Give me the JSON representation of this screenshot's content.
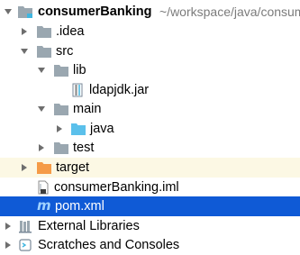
{
  "project_tree": {
    "root": {
      "name": "consumerBanking",
      "path": "~/workspace/java/consumer"
    },
    "idea": {
      "name": ".idea"
    },
    "src": {
      "name": "src"
    },
    "lib": {
      "name": "lib"
    },
    "jar": {
      "name": "ldapjdk.jar"
    },
    "main": {
      "name": "main"
    },
    "java": {
      "name": "java"
    },
    "test": {
      "name": "test"
    },
    "target": {
      "name": "target"
    },
    "iml": {
      "name": "consumerBanking.iml"
    },
    "pom": {
      "name": "pom.xml"
    },
    "external_libraries": {
      "name": "External Libraries"
    },
    "scratches": {
      "name": "Scratches and Consoles"
    }
  },
  "colors": {
    "selection": "#0f5ad6",
    "excluded_background": "#fcf8e4",
    "folder": "#9aa7b0",
    "source_folder": "#5bc0eb",
    "excluded_folder": "#f59b47",
    "path_text": "#7b7b7b"
  },
  "icons": {
    "root": "module-folder-icon",
    "idea": "folder-icon",
    "src": "folder-icon",
    "lib": "folder-icon",
    "jar": "jar-file-icon",
    "main": "folder-icon",
    "java": "source-folder-icon",
    "test": "folder-icon",
    "target": "excluded-folder-icon",
    "iml": "iml-file-icon",
    "pom": "maven-file-icon",
    "external_libraries": "libraries-icon",
    "scratches": "scratches-icon"
  }
}
